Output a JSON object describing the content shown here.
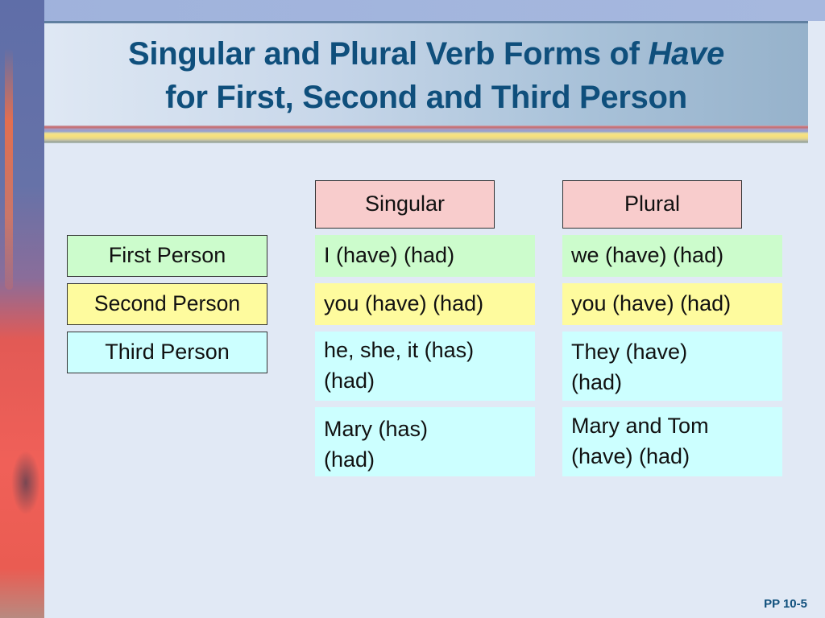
{
  "slide": {
    "title_line1_prefix": "Singular and Plural Verb Forms of ",
    "title_line1_emphasis": "Have",
    "title_line2": "for First, Second and Third Person",
    "page_number": "PP 10-5"
  },
  "table": {
    "column_headers": [
      "Singular",
      "Plural"
    ],
    "row_labels": [
      "First Person",
      "Second Person",
      "Third Person"
    ],
    "rows": [
      {
        "singular": "I (have) (had)",
        "plural": "we (have) (had)",
        "color": "#ccfccc"
      },
      {
        "singular": "you (have) (had)",
        "plural": "you (have) (had)",
        "color": "#fefb9e"
      },
      {
        "singular_line1": "he, she, it (has)",
        "singular_line2": "(had)",
        "plural_line1": "They (have)",
        "plural_line2": "(had)",
        "color": "#ccffff"
      },
      {
        "singular_line1": "Mary (has)",
        "singular_line2": "(had)",
        "plural_line1": "Mary and Tom",
        "plural_line2": "(have) (had)",
        "color": "#ccffff"
      }
    ]
  },
  "colors": {
    "title_text": "#0f4f7c",
    "header_fill": "#f8cccc",
    "first_person_fill": "#ccfccc",
    "second_person_fill": "#fefb9e",
    "third_person_fill": "#ccffff",
    "background": "#e1e9f5"
  }
}
